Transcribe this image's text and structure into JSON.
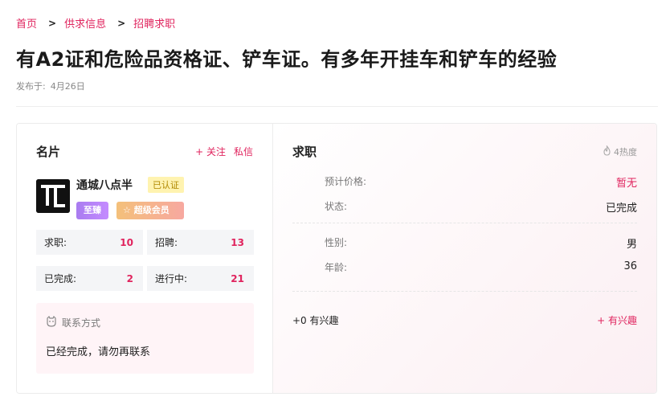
{
  "breadcrumb": [
    "首页",
    "供求信息",
    "招聘求职"
  ],
  "breadcrumb_sep": ">",
  "title": "有A2证和危险品资格证、铲车证。有多年开挂车和铲车的经验",
  "publish": {
    "label": "发布于:",
    "date": "4月26日"
  },
  "card": {
    "heading": "名片",
    "follow": "+ 关注",
    "message": "私信",
    "name": "通城八点半",
    "verified": "已认证",
    "vip": "至臻",
    "member": "☆ 超级会员",
    "stats": [
      {
        "label": "求职:",
        "value": "10"
      },
      {
        "label": "招聘:",
        "value": "13"
      },
      {
        "label": "已完成:",
        "value": "2"
      },
      {
        "label": "进行中:",
        "value": "21"
      }
    ],
    "contact_label": "联系方式",
    "contact_text": "已经完成，请勿再联系"
  },
  "job": {
    "heading": "求职",
    "heat": "4热度",
    "rows": [
      {
        "key": "预计价格:",
        "value": "暂无"
      },
      {
        "key": "状态:",
        "value": "已完成"
      },
      {
        "key": "性别:",
        "value": "男"
      },
      {
        "key": "年龄:",
        "value": "36"
      }
    ],
    "interest_count": "+0 有兴趣",
    "interest_btn": "+ 有兴趣"
  },
  "colors": {
    "accent": "#e0245e"
  }
}
